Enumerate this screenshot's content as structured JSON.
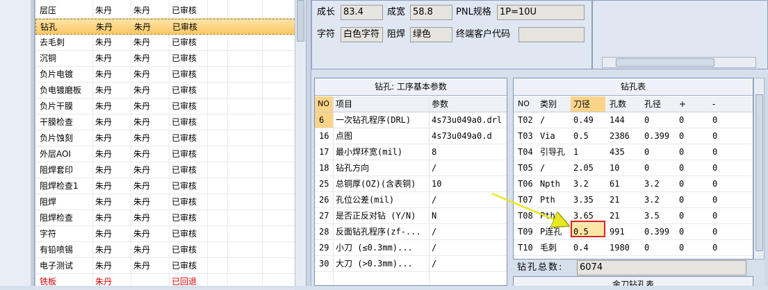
{
  "process_list": {
    "rows": [
      {
        "name": "层压",
        "c1": "朱丹",
        "c2": "朱丹",
        "status": "已审核"
      },
      {
        "name": "钻孔",
        "c1": "朱丹",
        "c2": "朱丹",
        "status": "已审核"
      },
      {
        "name": "去毛刺",
        "c1": "朱丹",
        "c2": "朱丹",
        "status": "已审核"
      },
      {
        "name": "沉铜",
        "c1": "朱丹",
        "c2": "朱丹",
        "status": "已审核"
      },
      {
        "name": "负片电镀",
        "c1": "朱丹",
        "c2": "朱丹",
        "status": "已审核"
      },
      {
        "name": "负电镀磨板",
        "c1": "朱丹",
        "c2": "朱丹",
        "status": "已审核"
      },
      {
        "name": "负片干膜",
        "c1": "朱丹",
        "c2": "朱丹",
        "status": "已审核"
      },
      {
        "name": "干膜检查",
        "c1": "朱丹",
        "c2": "朱丹",
        "status": "已审核"
      },
      {
        "name": "负片蚀刻",
        "c1": "朱丹",
        "c2": "朱丹",
        "status": "已审核"
      },
      {
        "name": "外层AOI",
        "c1": "朱丹",
        "c2": "朱丹",
        "status": "已审核"
      },
      {
        "name": "阻焊套印",
        "c1": "朱丹",
        "c2": "朱丹",
        "status": "已审核"
      },
      {
        "name": "阻焊检查1",
        "c1": "朱丹",
        "c2": "朱丹",
        "status": "已审核"
      },
      {
        "name": "阻焊",
        "c1": "朱丹",
        "c2": "朱丹",
        "status": "已审核"
      },
      {
        "name": "阻焊检查",
        "c1": "朱丹",
        "c2": "朱丹",
        "status": "已审核"
      },
      {
        "name": "字符",
        "c1": "朱丹",
        "c2": "朱丹",
        "status": "已审核"
      },
      {
        "name": "有铅喷锡",
        "c1": "朱丹",
        "c2": "朱丹",
        "status": "已审核"
      },
      {
        "name": "电子测试",
        "c1": "朱丹",
        "c2": "朱丹",
        "status": "已审核"
      },
      {
        "name": "铣板",
        "c1": "朱丹",
        "c2": "",
        "status": "已回退"
      }
    ]
  },
  "top_form": {
    "growth_label": "成长",
    "growth_value": "83.4",
    "width_label": "成宽",
    "width_value": "58.8",
    "pnl_label": "PNL规格",
    "pnl_value": "1P=10U",
    "char_label": "字符",
    "char_value": "白色字符",
    "mask_label": "阻焊",
    "mask_value": "绿色",
    "customer_label": "终端客户代码",
    "customer_value": ""
  },
  "params": {
    "title": "钻孔: 工序基本参数",
    "headers": {
      "no": "NO",
      "item": "项目",
      "value": "参数"
    },
    "rows": [
      {
        "no": "6",
        "item": "一次钻孔程序(DRL)",
        "value": "4s73u049a0.drl"
      },
      {
        "no": "16",
        "item": "点图",
        "value": "4s73u049a0.d"
      },
      {
        "no": "17",
        "item": "最小焊环宽(mil)",
        "value": "8"
      },
      {
        "no": "18",
        "item": "钻孔方向",
        "value": "/"
      },
      {
        "no": "25",
        "item": "总铜厚(OZ)(含表铜)",
        "value": "10"
      },
      {
        "no": "26",
        "item": "孔位公差(mil)",
        "value": "/"
      },
      {
        "no": "27",
        "item": "是否正反对钻 (Y/N)",
        "value": "N"
      },
      {
        "no": "28",
        "item": "反面钻孔程序(zf-...",
        "value": "/"
      },
      {
        "no": "29",
        "item": "小刀 (≤0.3mm)...",
        "value": "/"
      },
      {
        "no": "30",
        "item": "大刀 (>0.3mm)...",
        "value": "/"
      }
    ]
  },
  "drill_table": {
    "title": "钻孔表",
    "headers": {
      "no": "NO",
      "type": "类别",
      "dia": "刀径",
      "count": "孔数",
      "hole": "孔径",
      "plus": "+",
      "minus": "-"
    },
    "rows": [
      {
        "no": "T02",
        "type": "/",
        "dia": "0.49",
        "count": "144",
        "hole": "0",
        "plus": "0",
        "minus": "0"
      },
      {
        "no": "T03",
        "type": "Via",
        "dia": "0.5",
        "count": "2386",
        "hole": "0.399",
        "plus": "0",
        "minus": "0"
      },
      {
        "no": "T04",
        "type": "引导孔",
        "dia": "1",
        "count": "435",
        "hole": "0",
        "plus": "0",
        "minus": "0"
      },
      {
        "no": "T05",
        "type": "/",
        "dia": "2.05",
        "count": "10",
        "hole": "0",
        "plus": "0",
        "minus": "0"
      },
      {
        "no": "T06",
        "type": "Npth",
        "dia": "3.2",
        "count": "61",
        "hole": "3.2",
        "plus": "0",
        "minus": "0"
      },
      {
        "no": "T07",
        "type": "Pth",
        "dia": "3.35",
        "count": "21",
        "hole": "3.2",
        "plus": "0",
        "minus": "0"
      },
      {
        "no": "T08",
        "type": "Pth",
        "dia": "3.65",
        "count": "21",
        "hole": "3.5",
        "plus": "0",
        "minus": "0"
      },
      {
        "no": "T09",
        "type": "P连孔",
        "dia": "0.5",
        "count": "991",
        "hole": "0.399",
        "plus": "0",
        "minus": "0"
      },
      {
        "no": "T10",
        "type": "毛刺",
        "dia": "0.4",
        "count": "1980",
        "hole": "0",
        "plus": "0",
        "minus": "0"
      }
    ],
    "total_label": "钻孔总数:",
    "total_value": "6074",
    "bottom_title": "金刀钻孔表"
  },
  "colors": {
    "selected_row": "#fbc766",
    "highlight_border": "#e02020",
    "arrow": "#e8e820",
    "reverted_text": "#e00000"
  }
}
